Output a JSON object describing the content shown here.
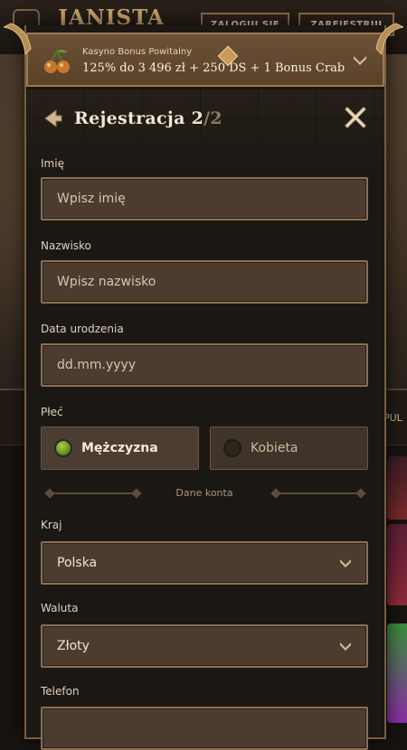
{
  "background": {
    "logo": "JANISTA",
    "login_label": "ZALOGUJ SIĘ",
    "register_label": "ZAREJESTRUJ",
    "side_label": "PUL"
  },
  "bonus": {
    "title": "Kasyno Bonus Powitalny",
    "text": "125% do 3 496 zł + 250 DS + 1 Bonus Crab",
    "icon": "cherries-icon"
  },
  "header": {
    "title": "Rejestracja",
    "step_current": "2",
    "step_total": "/2"
  },
  "form": {
    "first_name": {
      "label": "Imię",
      "placeholder": "Wpisz imię"
    },
    "last_name": {
      "label": "Nazwisko",
      "placeholder": "Wpisz nazwisko"
    },
    "birth_date": {
      "label": "Data urodzenia",
      "placeholder": "dd.mm.yyyy"
    },
    "gender": {
      "label": "Płeć",
      "options": [
        {
          "label": "Mężczyzna",
          "selected": true
        },
        {
          "label": "Kobieta",
          "selected": false
        }
      ]
    },
    "section_divider": "Dane konta",
    "country": {
      "label": "Kraj",
      "value": "Polska"
    },
    "currency": {
      "label": "Waluta",
      "value": "Złoty"
    },
    "phone": {
      "label": "Telefon"
    }
  },
  "colors": {
    "accent_gold": "#9b7a4f",
    "field_bg": "#4b3c2f",
    "radio_selected": "#7fae2e"
  }
}
